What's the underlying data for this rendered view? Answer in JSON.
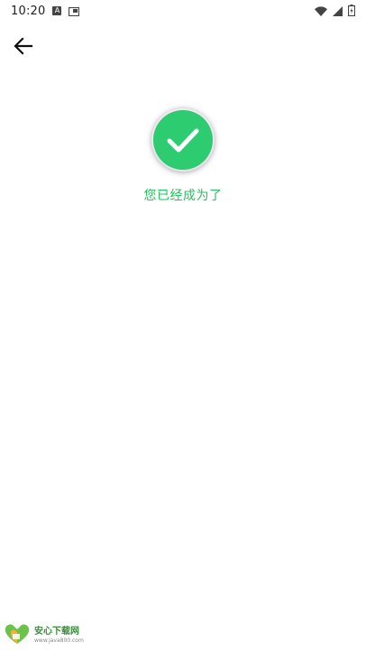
{
  "status_bar": {
    "time": "10:20",
    "notification_icon_a": "A",
    "icons": [
      "wifi-icon",
      "signal-icon",
      "battery-icon"
    ]
  },
  "toolbar": {
    "back_icon": "arrow-left-icon"
  },
  "success": {
    "icon": "check-circle-icon",
    "message": "您已经成为了",
    "color": "#2ecc71",
    "text_color": "#22c35e"
  },
  "watermark": {
    "title": "安心下载网",
    "url": "www.java800.com",
    "logo_icon": "heart-leaf-logo"
  }
}
